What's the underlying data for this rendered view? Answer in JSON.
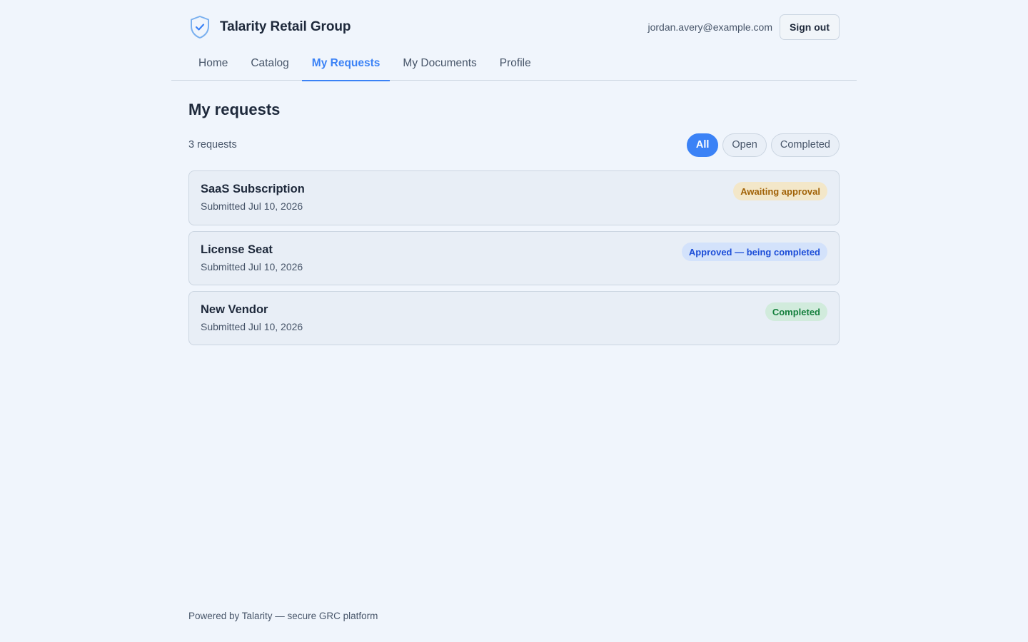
{
  "brand": {
    "name": "Talarity Retail Group",
    "icon": "shield-check-icon"
  },
  "user": {
    "email": "jordan.avery@example.com",
    "signout_label": "Sign out"
  },
  "nav": {
    "tabs": [
      {
        "label": "Home",
        "active": false
      },
      {
        "label": "Catalog",
        "active": false
      },
      {
        "label": "My Requests",
        "active": true
      },
      {
        "label": "My Documents",
        "active": false
      },
      {
        "label": "Profile",
        "active": false
      }
    ]
  },
  "main": {
    "title": "My requests",
    "count": "3 requests",
    "filters": [
      {
        "label": "All",
        "active": true
      },
      {
        "label": "Open",
        "active": false
      },
      {
        "label": "Completed",
        "active": false
      }
    ],
    "requests": [
      {
        "title": "SaaS Subscription",
        "submitted": "Submitted Jul 10, 2026",
        "status": "Awaiting approval",
        "status_color": "#a16207"
      },
      {
        "title": "License Seat",
        "submitted": "Submitted Jul 10, 2026",
        "status": "Approved — being completed",
        "status_color": "#1d4ed8"
      },
      {
        "title": "New Vendor",
        "submitted": "Submitted Jul 10, 2026",
        "status": "Completed",
        "status_color": "#15803d"
      }
    ]
  },
  "footer": {
    "text": "Powered by Talarity — secure GRC platform"
  },
  "colors": {
    "accent": "#3b82f6",
    "background": "#f0f5fc",
    "text": "#1e293b"
  }
}
